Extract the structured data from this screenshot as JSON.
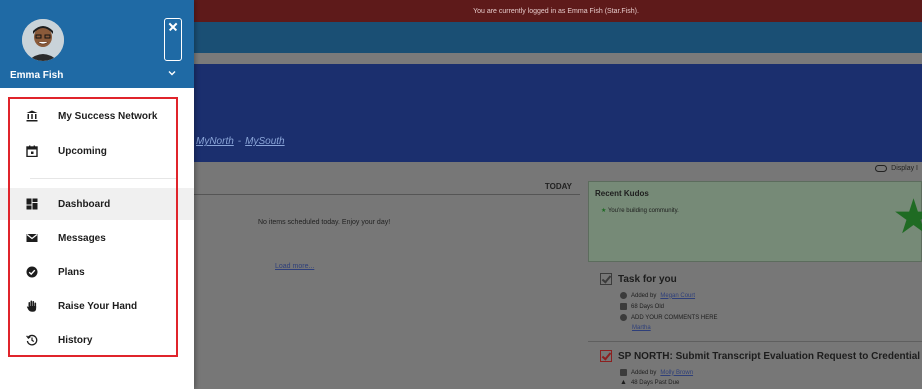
{
  "background": {
    "notice": "You are currently logged in as Emma Fish (Star.Fish).",
    "links": [
      "MyNorth",
      "MySouth"
    ],
    "links_sep": "-",
    "display_toggle_label": "Display I",
    "today_label": "TODAY",
    "no_items_text": "No items scheduled today. Enjoy your day!",
    "load_more": "Load more...",
    "kudos": {
      "title": "Recent Kudos",
      "message": "You're building community."
    },
    "tasks": [
      {
        "title": "Task for you",
        "added_prefix": "Added by",
        "added_by": "Megan Court",
        "age": "68 Days Old",
        "note": "ADD YOUR COMMENTS HERE",
        "link": "Martha"
      },
      {
        "title": "SP NORTH: Submit Transcript Evaluation Request to Credential Office",
        "added_prefix": "Added by",
        "added_by": "Molly Brown",
        "age": "48 Days Past Due"
      }
    ]
  },
  "drawer": {
    "user_name": "Emma Fish",
    "colors": {
      "header": "#1f6aa5",
      "highlight_frame": "#e0242b"
    },
    "menu_top": [
      {
        "label": "My Success Network",
        "icon": "bank-icon"
      },
      {
        "label": "Upcoming",
        "icon": "calendar-icon"
      }
    ],
    "menu_bottom": [
      {
        "label": "Dashboard",
        "icon": "dashboard-icon",
        "active": true
      },
      {
        "label": "Messages",
        "icon": "envelope-icon"
      },
      {
        "label": "Plans",
        "icon": "check-circle-icon"
      },
      {
        "label": "Raise Your Hand",
        "icon": "hand-icon"
      },
      {
        "label": "History",
        "icon": "history-icon"
      }
    ]
  }
}
